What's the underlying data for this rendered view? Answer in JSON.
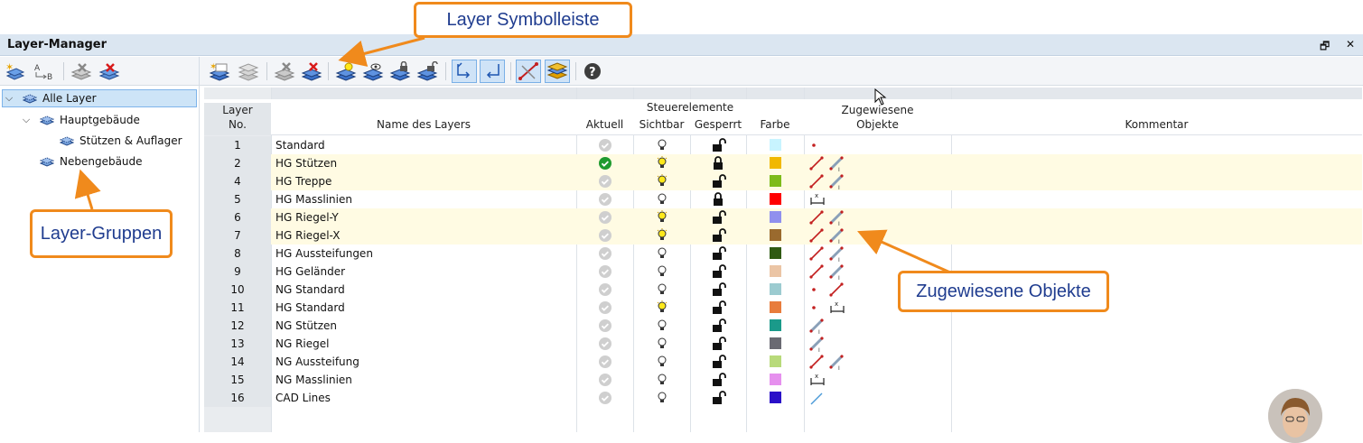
{
  "window": {
    "title": "Layer-Manager",
    "restore_glyph": "🗗",
    "close_glyph": "✕"
  },
  "callouts": {
    "toolbar": "Layer Symbolleiste",
    "groups": "Layer-Gruppen",
    "objects": "Zugewiesene Objekte"
  },
  "tree": [
    {
      "label": "Alle Layer",
      "expanded": true,
      "selected": true
    },
    {
      "label": "Hauptgebäude",
      "expanded": true
    },
    {
      "label": "Stützen & Auflager"
    },
    {
      "label": "Nebengebäude"
    }
  ],
  "table": {
    "headers": {
      "no": "Layer\nNo.",
      "name": "Name des Layers",
      "controls": "Steuerelemente",
      "current": "Aktuell",
      "visible": "Sichtbar",
      "locked": "Gesperrt",
      "color": "Farbe",
      "assigned": "Zugewiesene\nObjekte",
      "comment": "Kommentar"
    },
    "rows": [
      {
        "no": "1",
        "name": "Standard",
        "current": false,
        "visible": false,
        "locked": false,
        "color": "#c8f4ff",
        "objs": [
          "node"
        ],
        "hl": false
      },
      {
        "no": "2",
        "name": "HG Stützen",
        "current": true,
        "visible": true,
        "locked": true,
        "color": "#f1b800",
        "objs": [
          "line",
          "member"
        ],
        "hl": true
      },
      {
        "no": "4",
        "name": "HG Treppe",
        "current": false,
        "visible": true,
        "locked": false,
        "color": "#7dbb1a",
        "objs": [
          "line",
          "member"
        ],
        "hl": true
      },
      {
        "no": "5",
        "name": "HG Masslinien",
        "current": false,
        "visible": false,
        "locked": true,
        "color": "#ff0000",
        "objs": [
          "dim"
        ],
        "hl": false
      },
      {
        "no": "6",
        "name": "HG Riegel-Y",
        "current": false,
        "visible": true,
        "locked": false,
        "color": "#9090ee",
        "objs": [
          "line",
          "member"
        ],
        "hl": true
      },
      {
        "no": "7",
        "name": "HG Riegel-X",
        "current": false,
        "visible": true,
        "locked": false,
        "color": "#9a6a2e",
        "objs": [
          "line",
          "member"
        ],
        "hl": true
      },
      {
        "no": "8",
        "name": "HG Aussteifungen",
        "current": false,
        "visible": false,
        "locked": false,
        "color": "#2f5a12",
        "objs": [
          "line",
          "member"
        ],
        "hl": false
      },
      {
        "no": "9",
        "name": "HG Geländer",
        "current": false,
        "visible": false,
        "locked": false,
        "color": "#ebc5a5",
        "objs": [
          "line",
          "member"
        ],
        "hl": false
      },
      {
        "no": "10",
        "name": "NG Standard",
        "current": false,
        "visible": false,
        "locked": false,
        "color": "#9ccbd0",
        "objs": [
          "node",
          "line"
        ],
        "hl": false
      },
      {
        "no": "11",
        "name": "HG Standard",
        "current": false,
        "visible": true,
        "locked": false,
        "color": "#e87c3c",
        "objs": [
          "node",
          "dim"
        ],
        "hl": false
      },
      {
        "no": "12",
        "name": "NG Stützen",
        "current": false,
        "visible": false,
        "locked": false,
        "color": "#1a9a8a",
        "objs": [
          "member"
        ],
        "hl": false
      },
      {
        "no": "13",
        "name": "NG Riegel",
        "current": false,
        "visible": false,
        "locked": false,
        "color": "#6a6a72",
        "objs": [
          "member"
        ],
        "hl": false
      },
      {
        "no": "14",
        "name": "NG Aussteifung",
        "current": false,
        "visible": false,
        "locked": false,
        "color": "#b8da7a",
        "objs": [
          "line",
          "member"
        ],
        "hl": false
      },
      {
        "no": "15",
        "name": "NG Masslinien",
        "current": false,
        "visible": false,
        "locked": false,
        "color": "#e690ee",
        "objs": [
          "dim"
        ],
        "hl": false
      },
      {
        "no": "16",
        "name": "CAD Lines",
        "current": false,
        "visible": false,
        "locked": false,
        "color": "#2a10c8",
        "objs": [
          "cadline"
        ],
        "hl": false
      }
    ]
  },
  "icons": {
    "left_toolbar": [
      "new-layer-group-icon",
      "rename-icon",
      "delete-layer-group-icon",
      "delete-all-groups-icon"
    ],
    "right_toolbar": [
      "new-layer-icon",
      "copy-layer-icon",
      "delete-layer-icon",
      "delete-all-layers-icon",
      "set-current-layer-icon",
      "show-all-layers-icon",
      "lock-layers-icon",
      "unlock-layers-icon",
      "assign-objects-icon",
      "remove-objects-icon",
      "select-objects-icon",
      "layer-filter-icon",
      "help-icon"
    ]
  }
}
